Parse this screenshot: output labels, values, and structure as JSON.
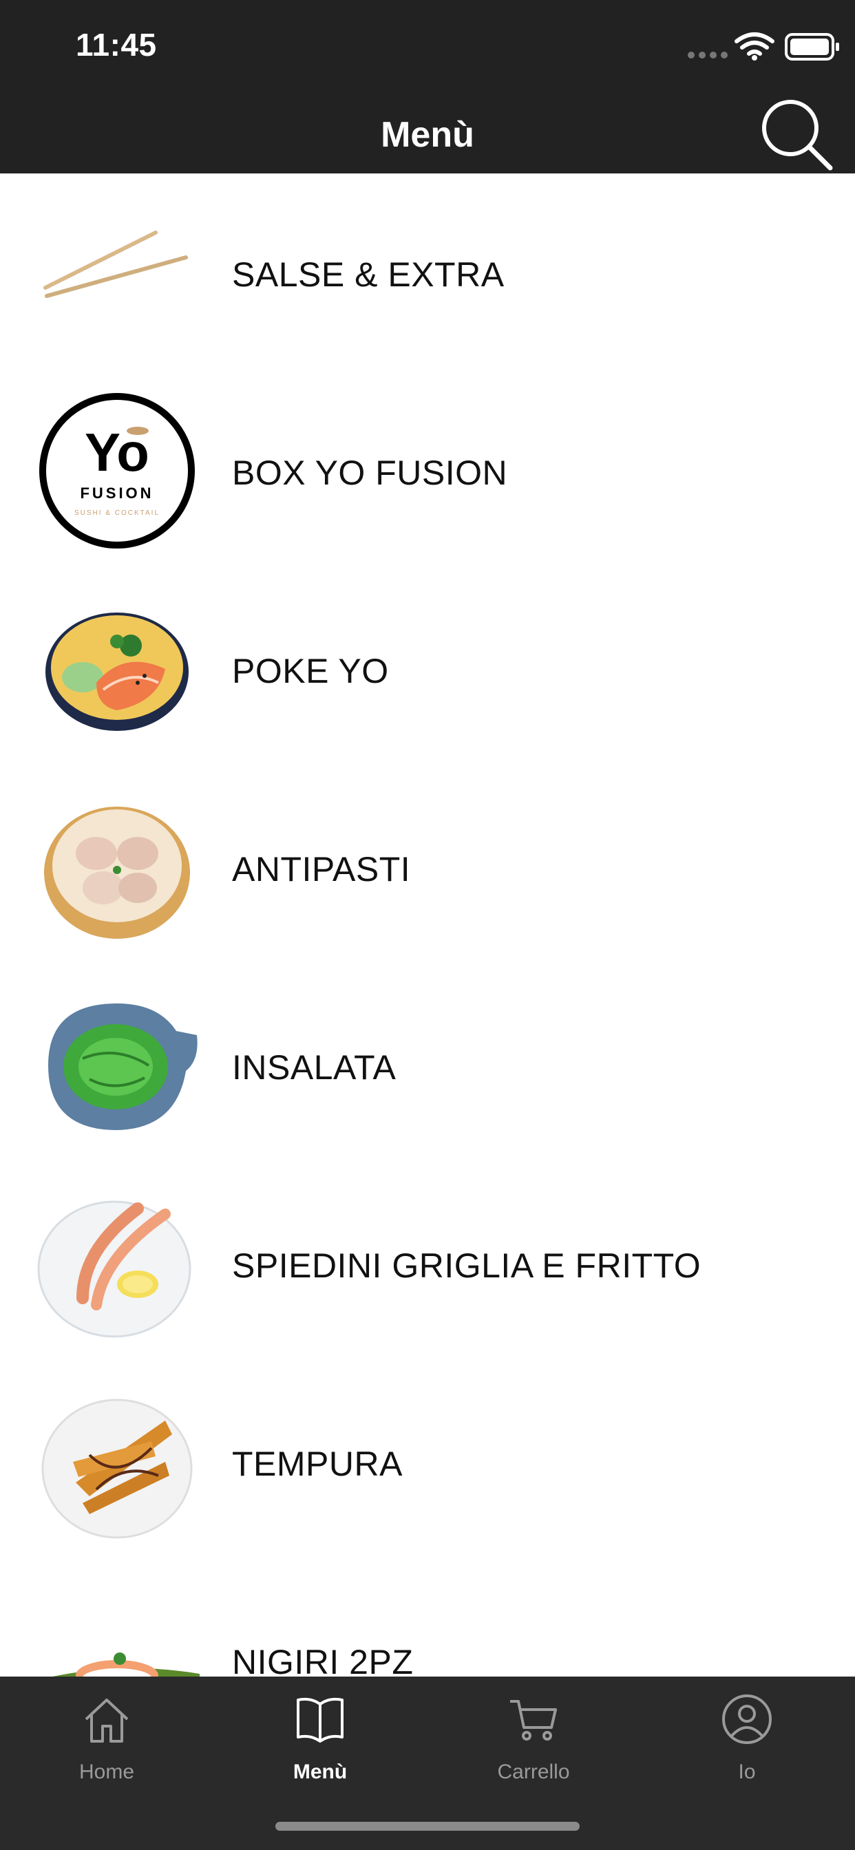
{
  "status_bar": {
    "time": "11:45"
  },
  "header": {
    "title": "Menù"
  },
  "menu_items": [
    {
      "label": "SALSE & EXTRA",
      "icon": "chopsticks-image"
    },
    {
      "label": "BOX YO FUSION",
      "icon": "yo-fusion-logo",
      "logo_text": "Yo",
      "logo_sub": "FUSION",
      "logo_tagline": "SUSHI & COCKTAIL"
    },
    {
      "label": "POKE YO",
      "icon": "poke-bowl-image"
    },
    {
      "label": "ANTIPASTI",
      "icon": "dumplings-steamer-image"
    },
    {
      "label": "INSALATA",
      "icon": "seaweed-salad-image"
    },
    {
      "label": "SPIEDINI GRIGLIA E FRITTO",
      "icon": "grilled-prawns-image"
    },
    {
      "label": "TEMPURA",
      "icon": "tempura-plate-image"
    },
    {
      "label": "NIGIRI 2PZ",
      "icon": "nigiri-image"
    }
  ],
  "tabbar": {
    "home": "Home",
    "menu": "Menù",
    "cart": "Carrello",
    "profile": "Io",
    "active": "menu"
  },
  "colors": {
    "bar_bg": "#222222",
    "tab_bg": "#2a2a2a",
    "active": "#ffffff",
    "inactive": "#9a9a9a"
  }
}
